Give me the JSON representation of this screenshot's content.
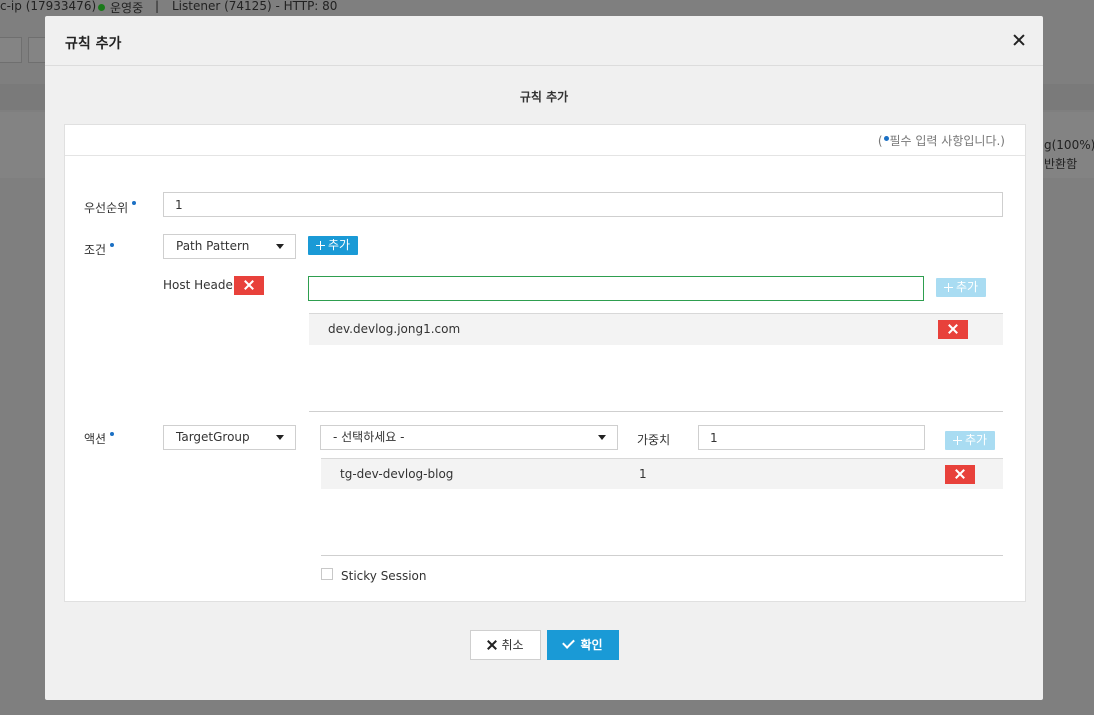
{
  "background": {
    "name_fragment": "c-ip (17933476)",
    "status": "운영중",
    "separator": "|",
    "listener": "Listener (74125) - HTTP: 80",
    "right_value": "g(100%)",
    "right_label": "반환함",
    "status_color": "#1a7a1a"
  },
  "modal": {
    "title": "규칙 추가",
    "subtitle": "규칙 추가",
    "close_icon": "close-icon",
    "required_note_open": "(",
    "required_note_text": "필수 입력 사항입니다.)",
    "priority": {
      "label": "우선순위",
      "value": "1"
    },
    "condition": {
      "label": "조건",
      "selected": "Path Pattern",
      "add_label": "추가",
      "host_header_label": "Host Header",
      "input_value": "",
      "input_add_label": "추가",
      "entries": [
        "dev.devlog.jong1.com"
      ]
    },
    "action": {
      "label": "액션",
      "selected": "TargetGroup",
      "target_select": "- 선택하세요 -",
      "weight_label": "가중치",
      "weight_value": "1",
      "add_label": "추가",
      "rows": [
        {
          "group": "tg-dev-devlog-blog",
          "weight": "1"
        }
      ],
      "sticky_label": "Sticky Session",
      "sticky_checked": false
    },
    "footer": {
      "cancel_label": "취소",
      "ok_label": "확인"
    }
  },
  "colors": {
    "primary": "#1a9ad6",
    "danger": "#e8413b",
    "focus": "#2e9e4f",
    "required_dot": "#1b70c4"
  }
}
